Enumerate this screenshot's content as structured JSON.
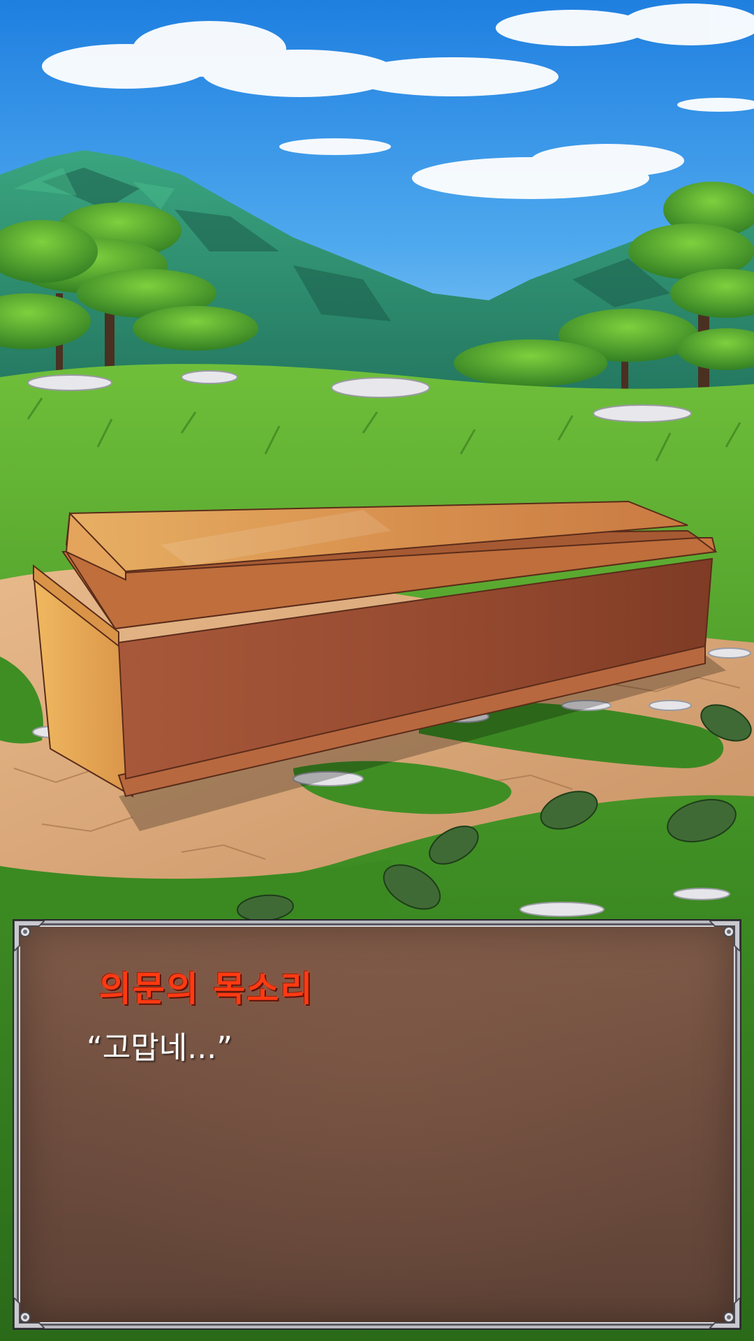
{
  "dialogue": {
    "speaker": "의문의 목소리",
    "text": "“고맙네...”"
  },
  "colors": {
    "speaker_name": "#ff3a12",
    "dialogue_text": "#ffffff",
    "box_fill": "#6f4e3f",
    "box_border": "#b9b9bf"
  }
}
